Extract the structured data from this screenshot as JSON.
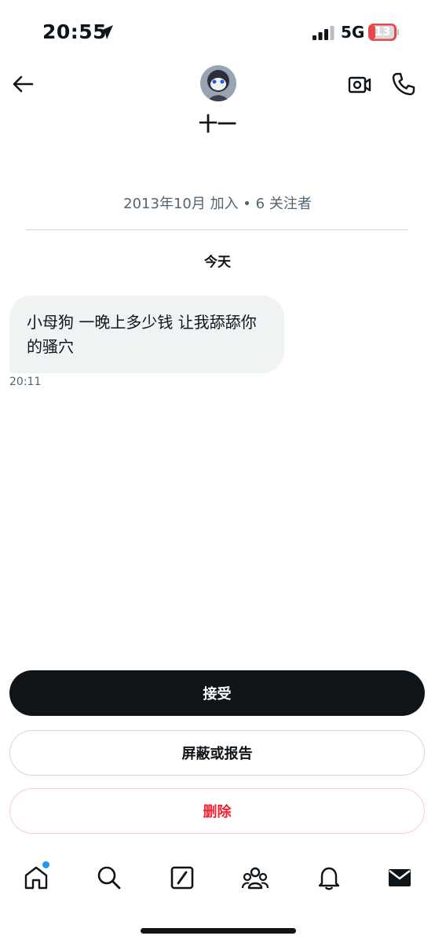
{
  "status_bar": {
    "time": "20:55",
    "network": "5G",
    "battery": "13"
  },
  "header": {
    "contact_name": "十一",
    "avatar": "avatar-image",
    "back_icon": "arrow-left-icon",
    "video_icon": "video-camera-icon",
    "phone_icon": "phone-icon"
  },
  "profile": {
    "meta": "2013年10月 加入 • 6 关注者"
  },
  "conversation": {
    "date_separator": "今天",
    "messages": [
      {
        "text": "小母狗 一晚上多少钱 让我舔舔你的骚穴",
        "time": "20:11"
      }
    ]
  },
  "actions": {
    "accept_label": "接受",
    "block_report_label": "屏蔽或报告",
    "delete_label": "删除"
  },
  "tab_bar": {
    "tabs": [
      "home-icon",
      "search-icon",
      "compose-icon",
      "communities-icon",
      "notifications-icon",
      "messages-icon"
    ],
    "active": "messages-icon"
  },
  "colors": {
    "accent_blue": "#1d9bf0",
    "danger_red": "#f4212e",
    "bubble_bg": "#eff3f4",
    "primary_dark": "#0f1419",
    "muted_text": "#536471"
  }
}
